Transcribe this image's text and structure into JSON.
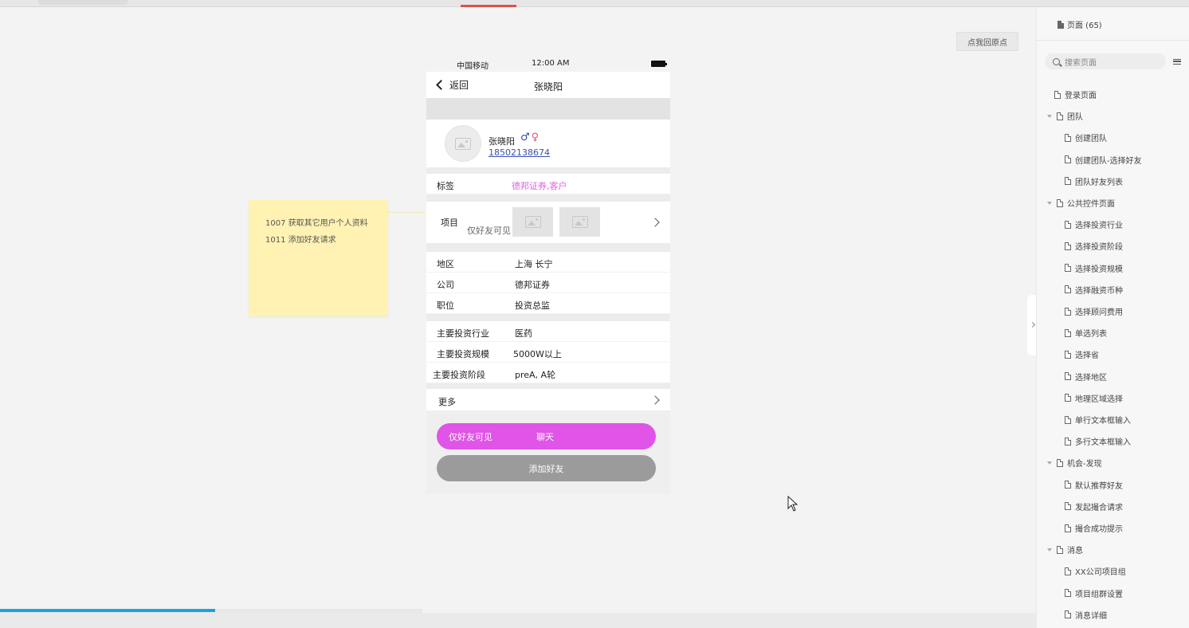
{
  "canvas": {
    "home_button": "点我回原点"
  },
  "sticky_note": {
    "lines": [
      "1007 获取其它用户个人资料",
      "1011 添加好友请求"
    ]
  },
  "phone": {
    "status": {
      "carrier": "中国移动",
      "time": "12:00 AM"
    },
    "nav": {
      "back": "返回",
      "title": "张晓阳"
    },
    "profile": {
      "name": "张晓阳",
      "phone": "18502138674",
      "male_icon": "male-icon",
      "female_icon": "female-icon"
    },
    "tags": {
      "label": "标签",
      "value": "德邦证券,客户"
    },
    "project": {
      "label": "项目",
      "note": "仅好友可见"
    },
    "info": [
      {
        "label": "地区",
        "value": "上海 长宁"
      },
      {
        "label": "公司",
        "value": "德邦证券"
      },
      {
        "label": "职位",
        "value": "投资总监"
      }
    ],
    "invest": [
      {
        "label": "主要投资行业",
        "value": "医药"
      },
      {
        "label": "主要投资规模",
        "value": "5000W以上"
      },
      {
        "label": "主要投资阶段",
        "value": "preA, A轮"
      }
    ],
    "more": {
      "label": "更多"
    },
    "chat_button": {
      "note": "仅好友可见",
      "label": "聊天"
    },
    "add_button": {
      "label": "添加好友"
    }
  },
  "panel": {
    "title": "页面 (65)",
    "search_placeholder": "搜索页面",
    "items": [
      {
        "label": "登录页面",
        "level": 0,
        "caret": false
      },
      {
        "label": "团队",
        "level": 0,
        "caret": true
      },
      {
        "label": "创建团队",
        "level": 1,
        "caret": false
      },
      {
        "label": "创建团队-选择好友",
        "level": 1,
        "caret": false
      },
      {
        "label": "团队好友列表",
        "level": 1,
        "caret": false
      },
      {
        "label": "公共控件页面",
        "level": 0,
        "caret": true
      },
      {
        "label": "选择投资行业",
        "level": 1,
        "caret": false
      },
      {
        "label": "选择投资阶段",
        "level": 1,
        "caret": false
      },
      {
        "label": "选择投资规模",
        "level": 1,
        "caret": false
      },
      {
        "label": "选择融资币种",
        "level": 1,
        "caret": false
      },
      {
        "label": "选择顾问费用",
        "level": 1,
        "caret": false
      },
      {
        "label": "单选列表",
        "level": 1,
        "caret": false
      },
      {
        "label": "选择省",
        "level": 1,
        "caret": false
      },
      {
        "label": "选择地区",
        "level": 1,
        "caret": false
      },
      {
        "label": "地理区域选择",
        "level": 1,
        "caret": false
      },
      {
        "label": "单行文本框输入",
        "level": 1,
        "caret": false
      },
      {
        "label": "多行文本框输入",
        "level": 1,
        "caret": false
      },
      {
        "label": "机会-发现",
        "level": 0,
        "caret": true
      },
      {
        "label": "默认推荐好友",
        "level": 1,
        "caret": false
      },
      {
        "label": "发起撮合请求",
        "level": 1,
        "caret": false
      },
      {
        "label": "撮合成功提示",
        "level": 1,
        "caret": false
      },
      {
        "label": "消息",
        "level": 0,
        "caret": true
      },
      {
        "label": "XX公司项目组",
        "level": 1,
        "caret": false
      },
      {
        "label": "项目组群设置",
        "level": 1,
        "caret": false
      },
      {
        "label": "消息详细",
        "level": 1,
        "caret": false
      }
    ]
  },
  "video_progress": 0.51
}
